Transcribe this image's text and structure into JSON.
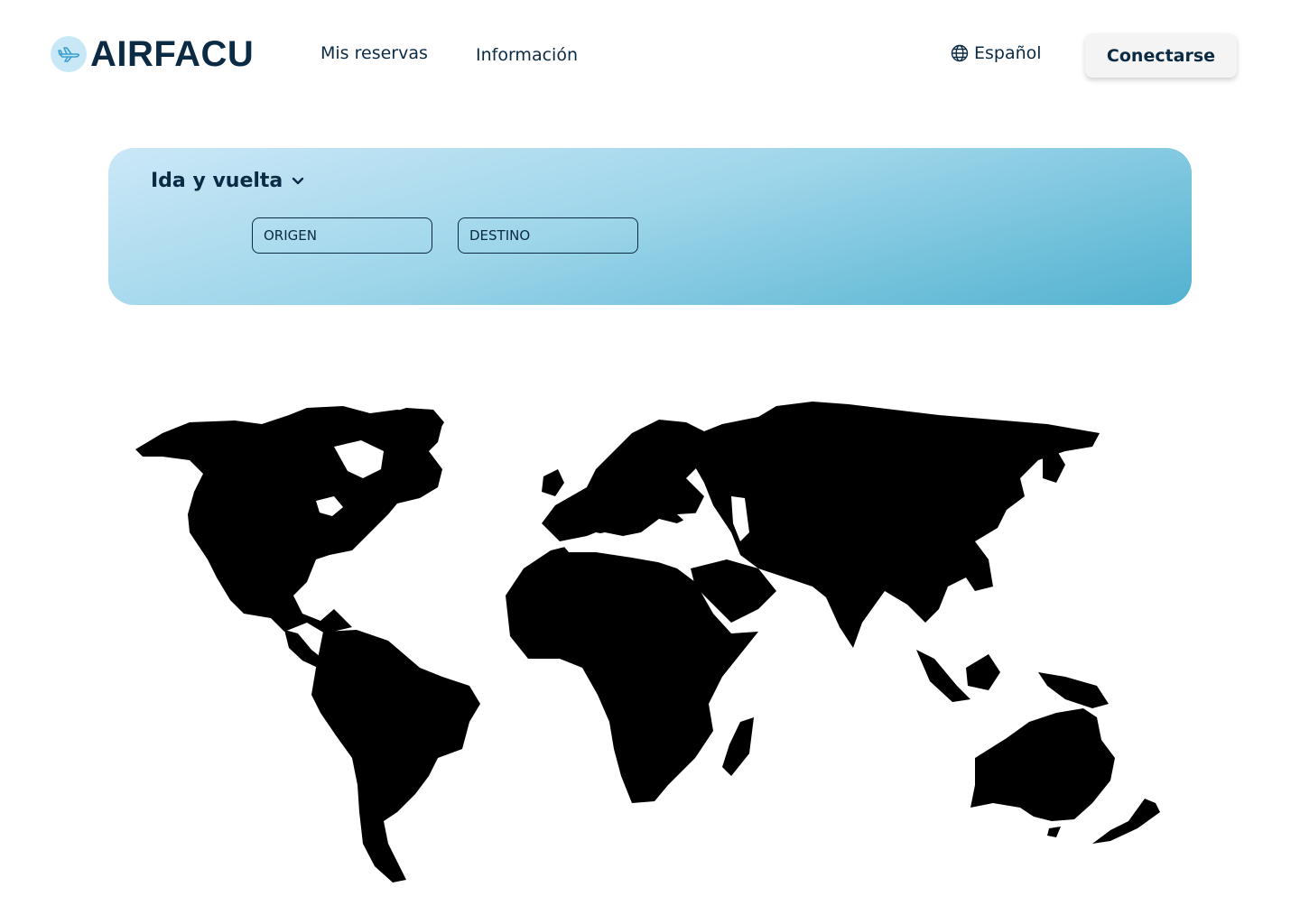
{
  "brand": {
    "name": "AIRFACU",
    "logo_icon": "airplane-icon"
  },
  "nav": {
    "items": [
      {
        "label": "Mis reservas"
      },
      {
        "label": "Información"
      }
    ]
  },
  "language": {
    "label": "Español",
    "icon": "globe-icon"
  },
  "auth": {
    "login_label": "Conectarse"
  },
  "search": {
    "trip_type": "Ida y vuelta",
    "origin_placeholder": "ORIGEN",
    "destination_placeholder": "DESTINO"
  },
  "map": {
    "description_icon": "world-map"
  },
  "colors": {
    "text": "#0b2a44",
    "panel_light": "#cbe8f7",
    "panel_dark": "#52b2d0",
    "button_bg": "#f4f4f4"
  }
}
